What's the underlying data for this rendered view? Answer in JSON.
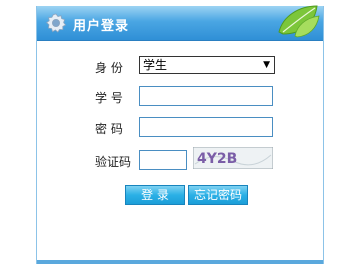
{
  "header": {
    "title": "用户登录"
  },
  "form": {
    "identity_label": "身 份",
    "identity_value": "学生",
    "student_id_label": "学 号",
    "password_label": "密 码",
    "captcha_label": "验证码",
    "captcha_text": "4Y2B"
  },
  "buttons": {
    "login": "登 录",
    "forgot": "忘记密码"
  },
  "colors": {
    "header_gradient_top": "#9dd3f3",
    "header_gradient_bottom": "#2f8fd6",
    "button_blue": "#2bb0e6",
    "panel_border": "#8cc3e8"
  },
  "icons": {
    "header_icon": "gear-icon",
    "decoration": "leaf-icon"
  }
}
